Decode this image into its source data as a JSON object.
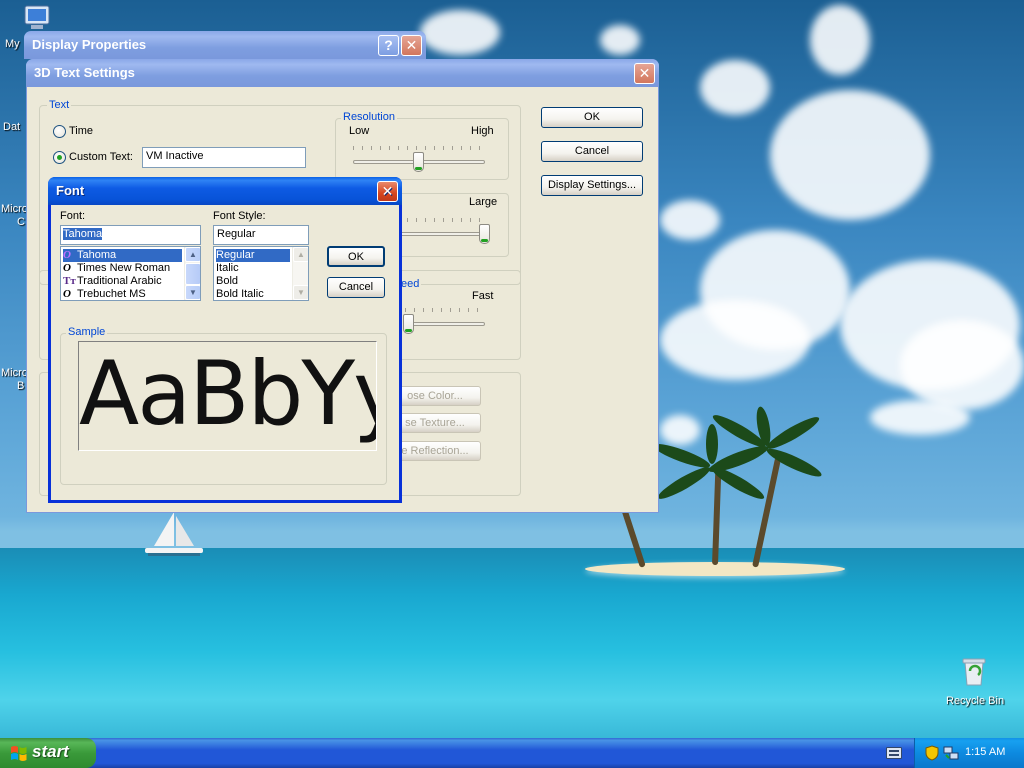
{
  "desktop": {
    "icons": [
      {
        "label": "My"
      },
      {
        "label": "Dat"
      },
      {
        "label": "Micro"
      },
      {
        "label": "C"
      },
      {
        "label": "Micro"
      },
      {
        "label": "B"
      }
    ],
    "recycle_bin": "Recycle Bin"
  },
  "display_properties": {
    "title": "Display Properties",
    "help_glyph": "?",
    "close_glyph": "✕"
  },
  "settings_dialog": {
    "title": "3D Text Settings",
    "close_glyph": "✕",
    "text_group": {
      "legend": "Text",
      "time_label": "Time",
      "custom_text_label": "Custom Text:",
      "custom_text_value": "VM Inactive",
      "selected_option": "custom"
    },
    "resolution": {
      "legend": "Resolution",
      "low": "Low",
      "high": "High",
      "level": 0.5
    },
    "size": {
      "large": "Large",
      "level": 1.0
    },
    "speed": {
      "legend_fragment": "eed",
      "fast": "Fast",
      "level": 0.05
    },
    "surface": {
      "color_button": "ose Color...",
      "texture_button": "se Texture...",
      "reflection_button": "e Reflection..."
    },
    "ok": "OK",
    "cancel": "Cancel",
    "display_settings": "Display Settings..."
  },
  "font_dialog": {
    "title": "Font",
    "close_glyph": "✕",
    "font_label": "Font:",
    "font_input": "Tahoma",
    "fonts": [
      {
        "glyph": "O",
        "name": "Tahoma",
        "selected": true
      },
      {
        "glyph": "O",
        "name": "Times New Roman",
        "selected": false
      },
      {
        "glyph": "Tт",
        "name": "Traditional Arabic",
        "selected": false
      },
      {
        "glyph": "O",
        "name": "Trebuchet MS",
        "selected": false
      }
    ],
    "style_label": "Font Style:",
    "style_input": "Regular",
    "styles": [
      {
        "name": "Regular",
        "selected": true
      },
      {
        "name": "Italic",
        "selected": false
      },
      {
        "name": "Bold",
        "selected": false
      },
      {
        "name": "Bold Italic",
        "selected": false
      }
    ],
    "ok": "OK",
    "cancel": "Cancel",
    "sample_legend": "Sample",
    "sample_text": "AaBbYy"
  },
  "taskbar": {
    "start": "start",
    "clock": "1:15 AM"
  }
}
